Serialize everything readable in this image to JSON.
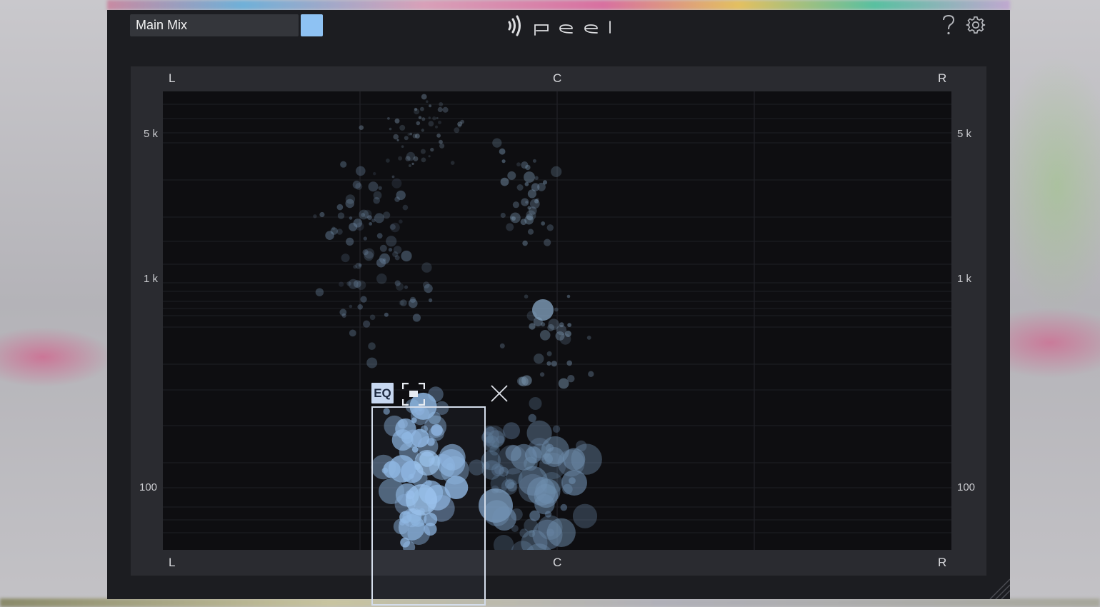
{
  "header": {
    "mix_name": "Main Mix",
    "swatch_color": "#8ec2f3",
    "logo_icon": "peel-logo",
    "help_icon": "question-icon",
    "settings_icon": "gear-icon"
  },
  "panel": {
    "top_axis": {
      "left": "L",
      "center": "C",
      "right": "R"
    },
    "bottom_axis": {
      "left": "L",
      "center": "C",
      "right": "R"
    },
    "frequency_labels_left": [
      "5 k",
      "1 k",
      "100"
    ],
    "frequency_labels_right": [
      "5 k",
      "1 k",
      "100"
    ]
  },
  "selection": {
    "eq_label": "EQ",
    "focus_icon": "focus-frame-icon",
    "close_icon": "close-icon"
  },
  "colors": {
    "accent": "#8ec2f3",
    "background": "#1c1d21",
    "panel": "#2a2b30",
    "display": "#0e0e11"
  }
}
